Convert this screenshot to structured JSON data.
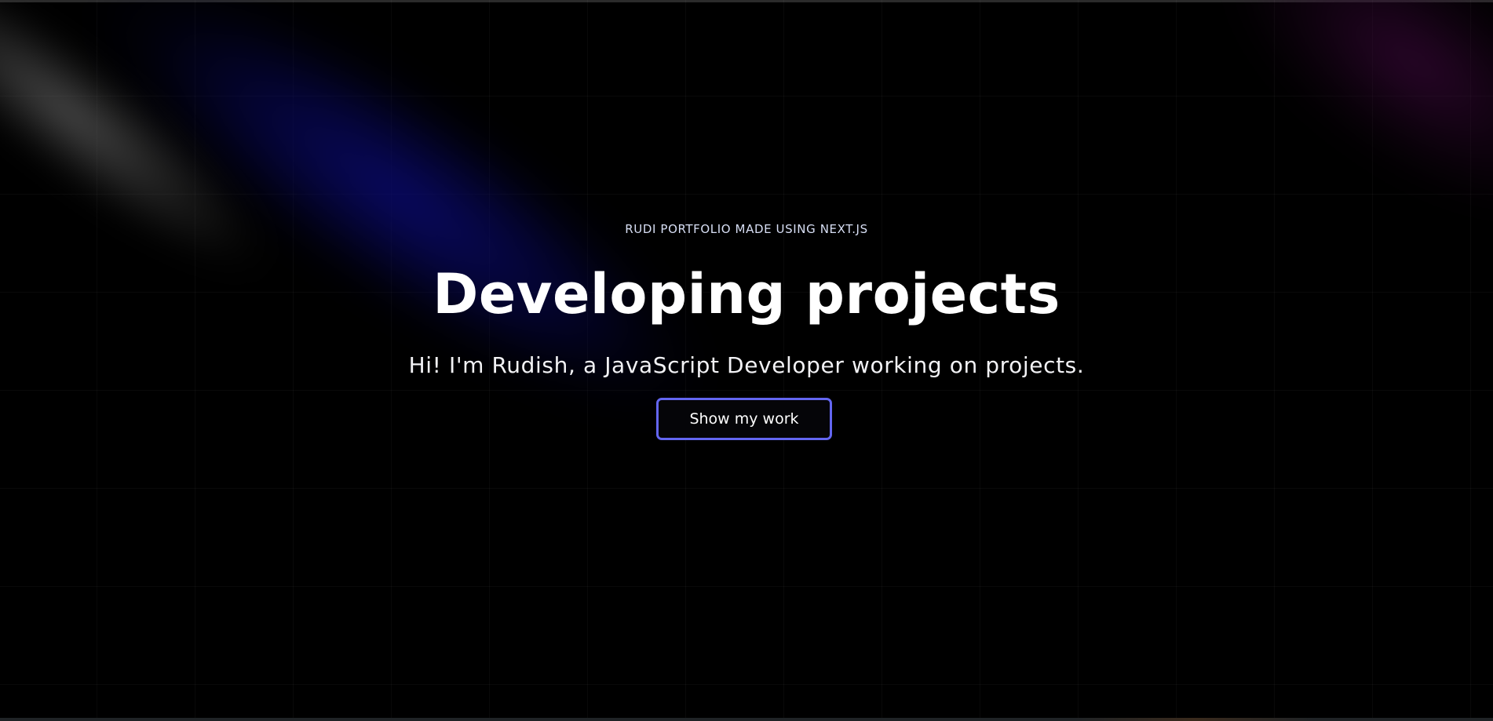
{
  "hero": {
    "eyebrow": "RUDI PORTFOLIO MADE USING NEXT.JS",
    "title": "Developing projects",
    "subtitle": "Hi! I'm Rudish, a JavaScript Developer working on projects.",
    "cta_label": "Show my work"
  },
  "theme": {
    "background": "#000000",
    "accent": "#6366f1",
    "glow_blue": "#0c0c82",
    "glow_purple": "#460a46"
  }
}
